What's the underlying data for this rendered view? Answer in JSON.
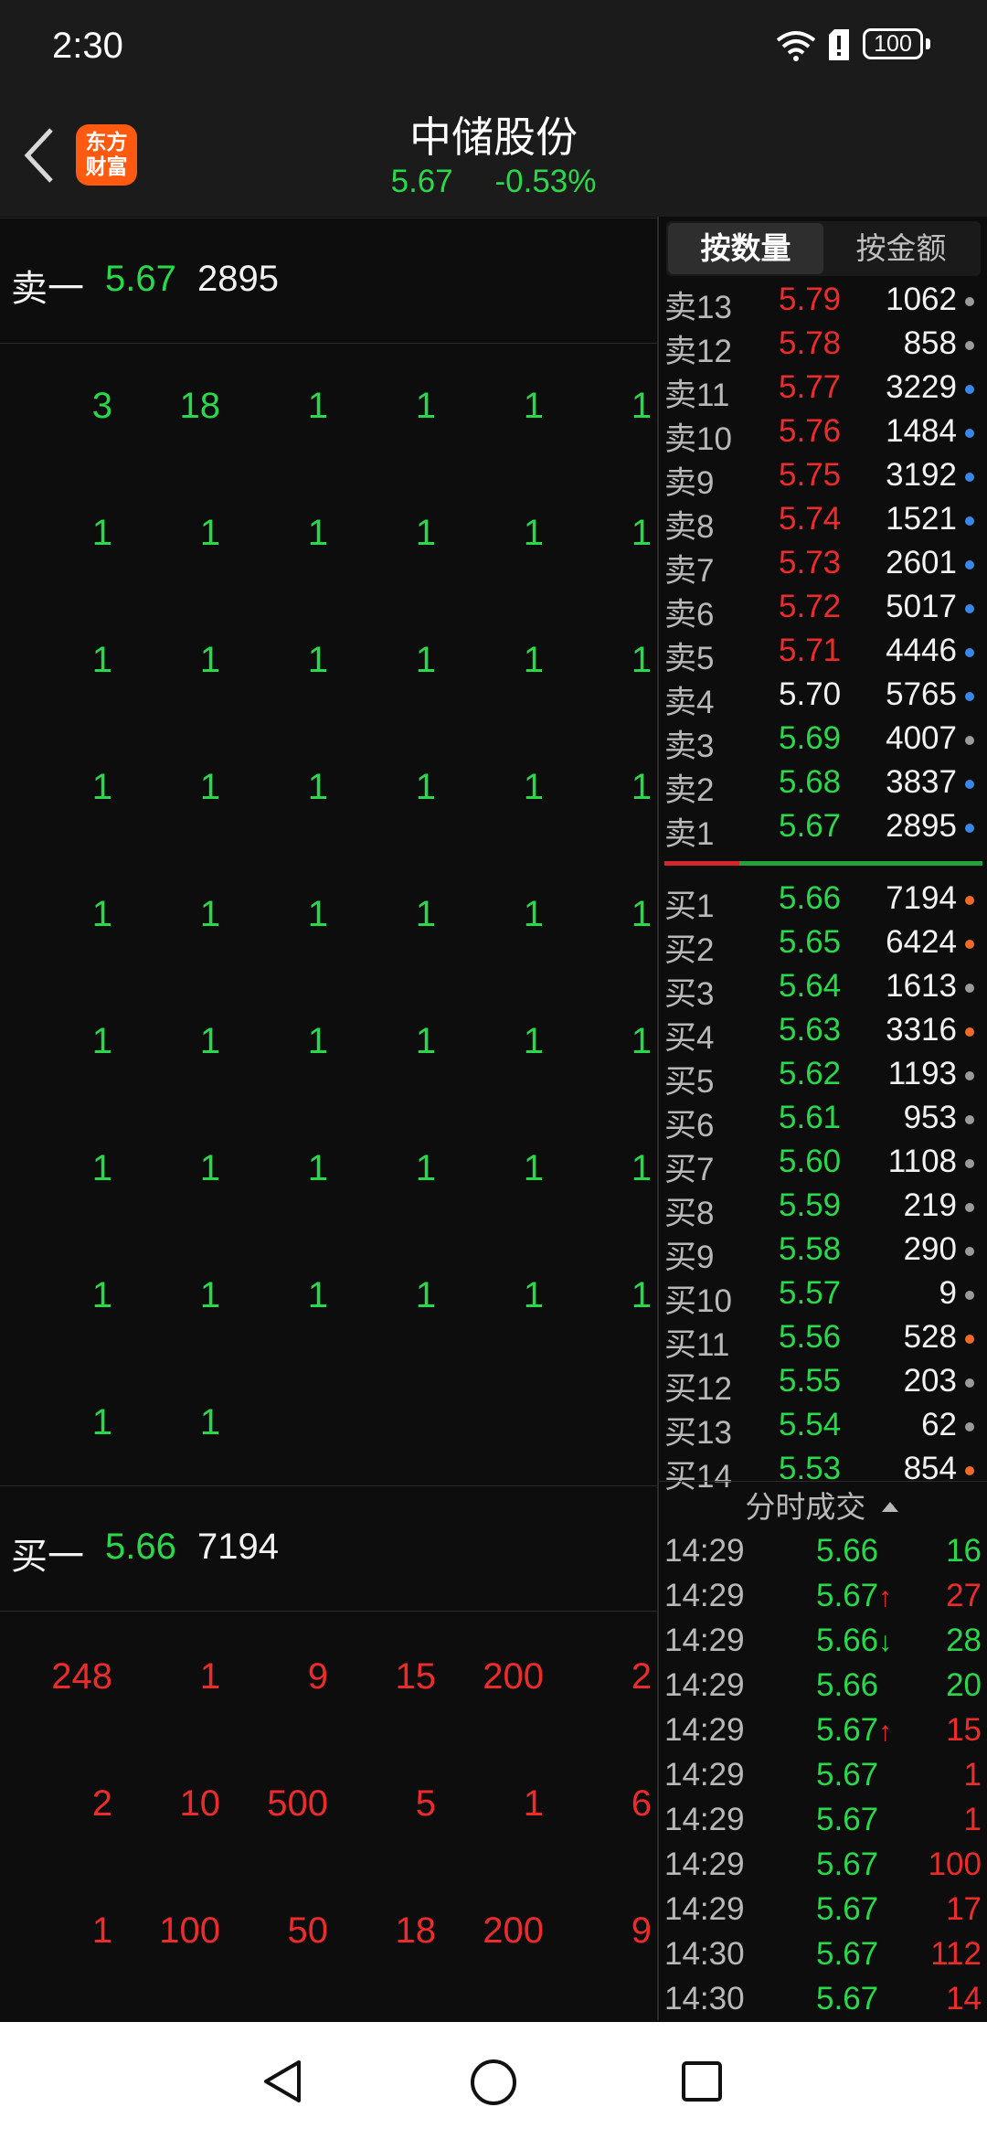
{
  "status_bar": {
    "time": "2:30",
    "battery": "100"
  },
  "header": {
    "logo_line1": "东方",
    "logo_line2": "财富",
    "title": "中储股份",
    "price": "5.67",
    "change_pct": "-0.53%"
  },
  "ask_queue": {
    "label": "卖一",
    "price": "5.67",
    "volume": "2895",
    "rows": [
      [
        "3",
        "18",
        "1",
        "1",
        "1",
        "1"
      ],
      [
        "1",
        "1",
        "1",
        "1",
        "1",
        "1"
      ],
      [
        "1",
        "1",
        "1",
        "1",
        "1",
        "1"
      ],
      [
        "1",
        "1",
        "1",
        "1",
        "1",
        "1"
      ],
      [
        "1",
        "1",
        "1",
        "1",
        "1",
        "1"
      ],
      [
        "1",
        "1",
        "1",
        "1",
        "1",
        "1"
      ],
      [
        "1",
        "1",
        "1",
        "1",
        "1",
        "1"
      ],
      [
        "1",
        "1",
        "1",
        "1",
        "1",
        "1"
      ],
      [
        "1",
        "1"
      ]
    ]
  },
  "bid_queue": {
    "label": "买一",
    "price": "5.66",
    "volume": "7194",
    "rows": [
      [
        "248",
        "1",
        "9",
        "15",
        "200",
        "2"
      ],
      [
        "2",
        "10",
        "500",
        "5",
        "1",
        "6"
      ],
      [
        "1",
        "100",
        "50",
        "18",
        "200",
        "9"
      ]
    ]
  },
  "tabs": {
    "by_quantity": "按数量",
    "by_amount": "按金额"
  },
  "orderbook": {
    "asks": [
      {
        "name": "卖13",
        "price": "5.79",
        "qty": "1062",
        "pc": "red",
        "dot": "gray"
      },
      {
        "name": "卖12",
        "price": "5.78",
        "qty": "858",
        "pc": "red",
        "dot": "gray"
      },
      {
        "name": "卖11",
        "price": "5.77",
        "qty": "3229",
        "pc": "red",
        "dot": "blue"
      },
      {
        "name": "卖10",
        "price": "5.76",
        "qty": "1484",
        "pc": "red",
        "dot": "blue"
      },
      {
        "name": "卖9",
        "price": "5.75",
        "qty": "3192",
        "pc": "red",
        "dot": "blue"
      },
      {
        "name": "卖8",
        "price": "5.74",
        "qty": "1521",
        "pc": "red",
        "dot": "blue"
      },
      {
        "name": "卖7",
        "price": "5.73",
        "qty": "2601",
        "pc": "red",
        "dot": "blue"
      },
      {
        "name": "卖6",
        "price": "5.72",
        "qty": "5017",
        "pc": "red",
        "dot": "blue"
      },
      {
        "name": "卖5",
        "price": "5.71",
        "qty": "4446",
        "pc": "red",
        "dot": "blue"
      },
      {
        "name": "卖4",
        "price": "5.70",
        "qty": "5765",
        "pc": "white",
        "dot": "blue"
      },
      {
        "name": "卖3",
        "price": "5.69",
        "qty": "4007",
        "pc": "green",
        "dot": "gray"
      },
      {
        "name": "卖2",
        "price": "5.68",
        "qty": "3837",
        "pc": "green",
        "dot": "blue"
      },
      {
        "name": "卖1",
        "price": "5.67",
        "qty": "2895",
        "pc": "green",
        "dot": "blue"
      }
    ],
    "bids": [
      {
        "name": "买1",
        "price": "5.66",
        "qty": "7194",
        "pc": "green",
        "dot": "orange"
      },
      {
        "name": "买2",
        "price": "5.65",
        "qty": "6424",
        "pc": "green",
        "dot": "orange"
      },
      {
        "name": "买3",
        "price": "5.64",
        "qty": "1613",
        "pc": "green",
        "dot": "gray"
      },
      {
        "name": "买4",
        "price": "5.63",
        "qty": "3316",
        "pc": "green",
        "dot": "orange"
      },
      {
        "name": "买5",
        "price": "5.62",
        "qty": "1193",
        "pc": "green",
        "dot": "gray"
      },
      {
        "name": "买6",
        "price": "5.61",
        "qty": "953",
        "pc": "green",
        "dot": "gray"
      },
      {
        "name": "买7",
        "price": "5.60",
        "qty": "1108",
        "pc": "green",
        "dot": "gray"
      },
      {
        "name": "买8",
        "price": "5.59",
        "qty": "219",
        "pc": "green",
        "dot": "gray"
      },
      {
        "name": "买9",
        "price": "5.58",
        "qty": "290",
        "pc": "green",
        "dot": "gray"
      },
      {
        "name": "买10",
        "price": "5.57",
        "qty": "9",
        "pc": "green",
        "dot": "gray"
      },
      {
        "name": "买11",
        "price": "5.56",
        "qty": "528",
        "pc": "green",
        "dot": "orange"
      },
      {
        "name": "买12",
        "price": "5.55",
        "qty": "203",
        "pc": "green",
        "dot": "gray"
      },
      {
        "name": "买13",
        "price": "5.54",
        "qty": "62",
        "pc": "green",
        "dot": "gray"
      },
      {
        "name": "买14",
        "price": "5.53",
        "qty": "854",
        "pc": "green",
        "dot": "orange"
      }
    ]
  },
  "ticks": {
    "title": "分时成交",
    "rows": [
      {
        "time": "14:29",
        "price": "5.66",
        "arrow": "",
        "vol": "16",
        "vc": "green"
      },
      {
        "time": "14:29",
        "price": "5.67",
        "arrow": "up",
        "vol": "27",
        "vc": "red"
      },
      {
        "time": "14:29",
        "price": "5.66",
        "arrow": "down",
        "vol": "28",
        "vc": "green"
      },
      {
        "time": "14:29",
        "price": "5.66",
        "arrow": "",
        "vol": "20",
        "vc": "green"
      },
      {
        "time": "14:29",
        "price": "5.67",
        "arrow": "up",
        "vol": "15",
        "vc": "red"
      },
      {
        "time": "14:29",
        "price": "5.67",
        "arrow": "",
        "vol": "1",
        "vc": "red"
      },
      {
        "time": "14:29",
        "price": "5.67",
        "arrow": "",
        "vol": "1",
        "vc": "red"
      },
      {
        "time": "14:29",
        "price": "5.67",
        "arrow": "",
        "vol": "100",
        "vc": "red"
      },
      {
        "time": "14:29",
        "price": "5.67",
        "arrow": "",
        "vol": "17",
        "vc": "red"
      },
      {
        "time": "14:30",
        "price": "5.67",
        "arrow": "",
        "vol": "112",
        "vc": "red"
      },
      {
        "time": "14:30",
        "price": "5.67",
        "arrow": "",
        "vol": "14",
        "vc": "red"
      }
    ]
  },
  "colors": {
    "up": "#ee2b2b",
    "down": "#2ad94a",
    "accent": "#ff5a10"
  }
}
